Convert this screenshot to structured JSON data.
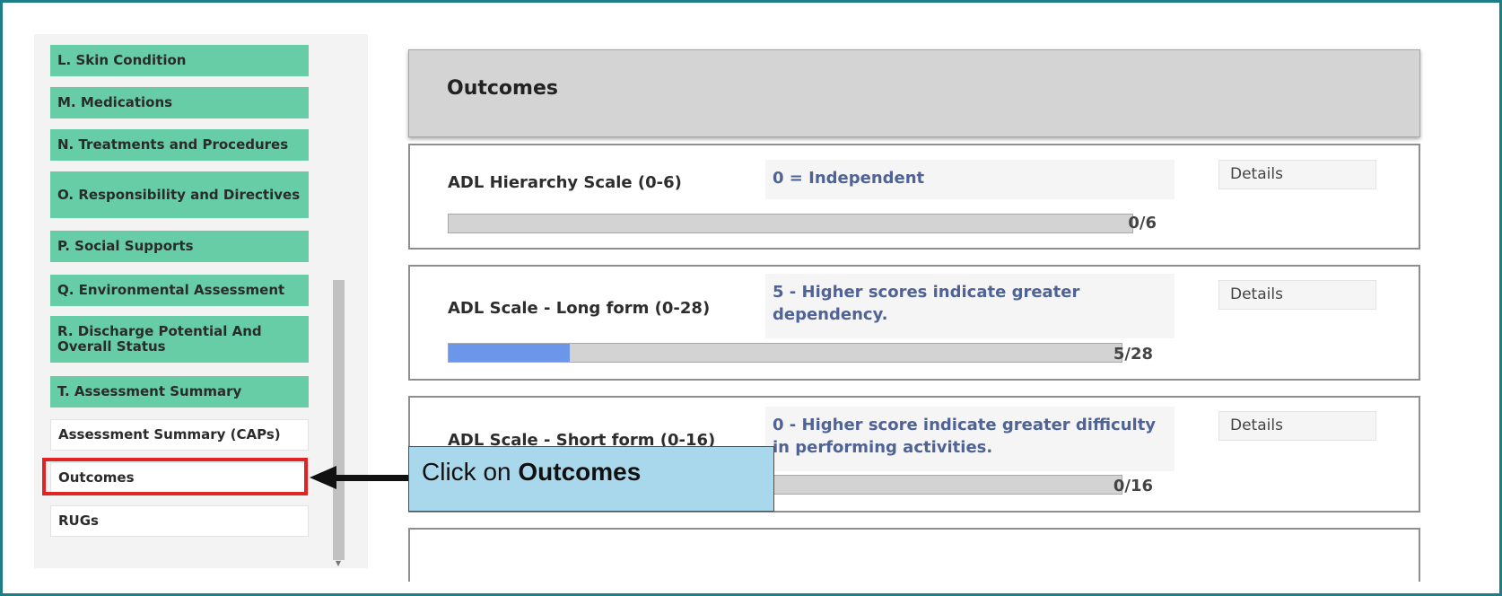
{
  "sidebar": {
    "items": [
      {
        "label": "L. Skin Condition"
      },
      {
        "label": "M. Medications"
      },
      {
        "label": "N. Treatments and Procedures"
      },
      {
        "label": "O. Responsibility and Directives"
      },
      {
        "label": "P. Social Supports"
      },
      {
        "label": "Q. Environmental Assessment"
      },
      {
        "label": "R. Discharge Potential And Overall Status"
      },
      {
        "label": "T. Assessment Summary"
      },
      {
        "label": "Assessment Summary (CAPs)"
      },
      {
        "label": "Outcomes"
      },
      {
        "label": "RUGs"
      }
    ]
  },
  "main": {
    "title": "Outcomes",
    "cards": [
      {
        "label": "ADL Hierarchy Scale (0-6)",
        "value": "0 = Independent",
        "details": "Details",
        "score": "0/6",
        "progress": 0
      },
      {
        "label": "ADL Scale - Long form (0-28)",
        "value": "5 - Higher scores indicate greater dependency.",
        "details": "Details",
        "score": "5/28",
        "progress": 0.18
      },
      {
        "label": "ADL Scale - Short form (0-16)",
        "value": "0 - Higher score indicate greater difficulty in performing activities.",
        "details": "Details",
        "score": "0/16",
        "progress": 0
      }
    ]
  },
  "callout": {
    "prefix": "Click on ",
    "bold": "Outcomes"
  },
  "colors": {
    "accent": "#66cda6",
    "frame": "#1d7e87",
    "highlight": "#e02424",
    "callout": "#a9d8ec",
    "progress": "#6b96ea"
  }
}
